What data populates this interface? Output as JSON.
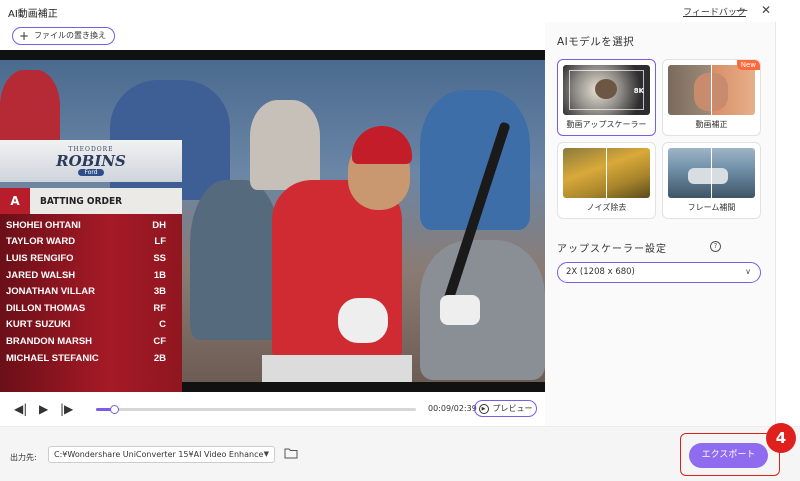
{
  "window": {
    "title": "AI動画補正",
    "feedback_link": "フィードバック",
    "minimize_icon": "minimize-icon",
    "close_icon": "close-icon"
  },
  "toolbar": {
    "change_file_label": "ファイルの置き換え"
  },
  "video": {
    "overlay": {
      "logo_top": "THEODORE",
      "logo_main": "ROBINS",
      "logo_sub": "Ford",
      "batting_order_title": "BATTING ORDER",
      "lineup": [
        {
          "name": "SHOHEI OHTANI",
          "pos": "DH"
        },
        {
          "name": "TAYLOR WARD",
          "pos": "LF"
        },
        {
          "name": "LUIS RENGIFO",
          "pos": "SS"
        },
        {
          "name": "JARED WALSH",
          "pos": "1B"
        },
        {
          "name": "JONATHAN VILLAR",
          "pos": "3B"
        },
        {
          "name": "DILLON THOMAS",
          "pos": "RF"
        },
        {
          "name": "KURT SUZUKI",
          "pos": "C"
        },
        {
          "name": "BRANDON MARSH",
          "pos": "CF"
        },
        {
          "name": "MICHAEL STEFANIC",
          "pos": "2B"
        }
      ]
    }
  },
  "player": {
    "time_display": "00:09/02:39",
    "progress_fraction": 0.057,
    "preview_label": "プレビュー"
  },
  "panel": {
    "heading": "AIモデルを選択",
    "models": [
      {
        "label": "動画アップスケーラー",
        "selected": true,
        "badge": "8K"
      },
      {
        "label": "動画補正",
        "selected": false,
        "badge": "New"
      },
      {
        "label": "ノイズ除去",
        "selected": false
      },
      {
        "label": "フレーム補間",
        "selected": false
      }
    ],
    "upscaler_setting_label": "アップスケーラー設定",
    "scale_value": "2X (1208 x 680)"
  },
  "bottom": {
    "output_label": "出力先:",
    "output_path": "C:¥Wondershare UniConverter 15¥AI Video Enhance",
    "export_label": "エクスポート",
    "step_number": "4"
  },
  "colors": {
    "accent": "#7b5ce6",
    "export_button": "#8f6bf0",
    "highlight_red": "#e0201d"
  }
}
